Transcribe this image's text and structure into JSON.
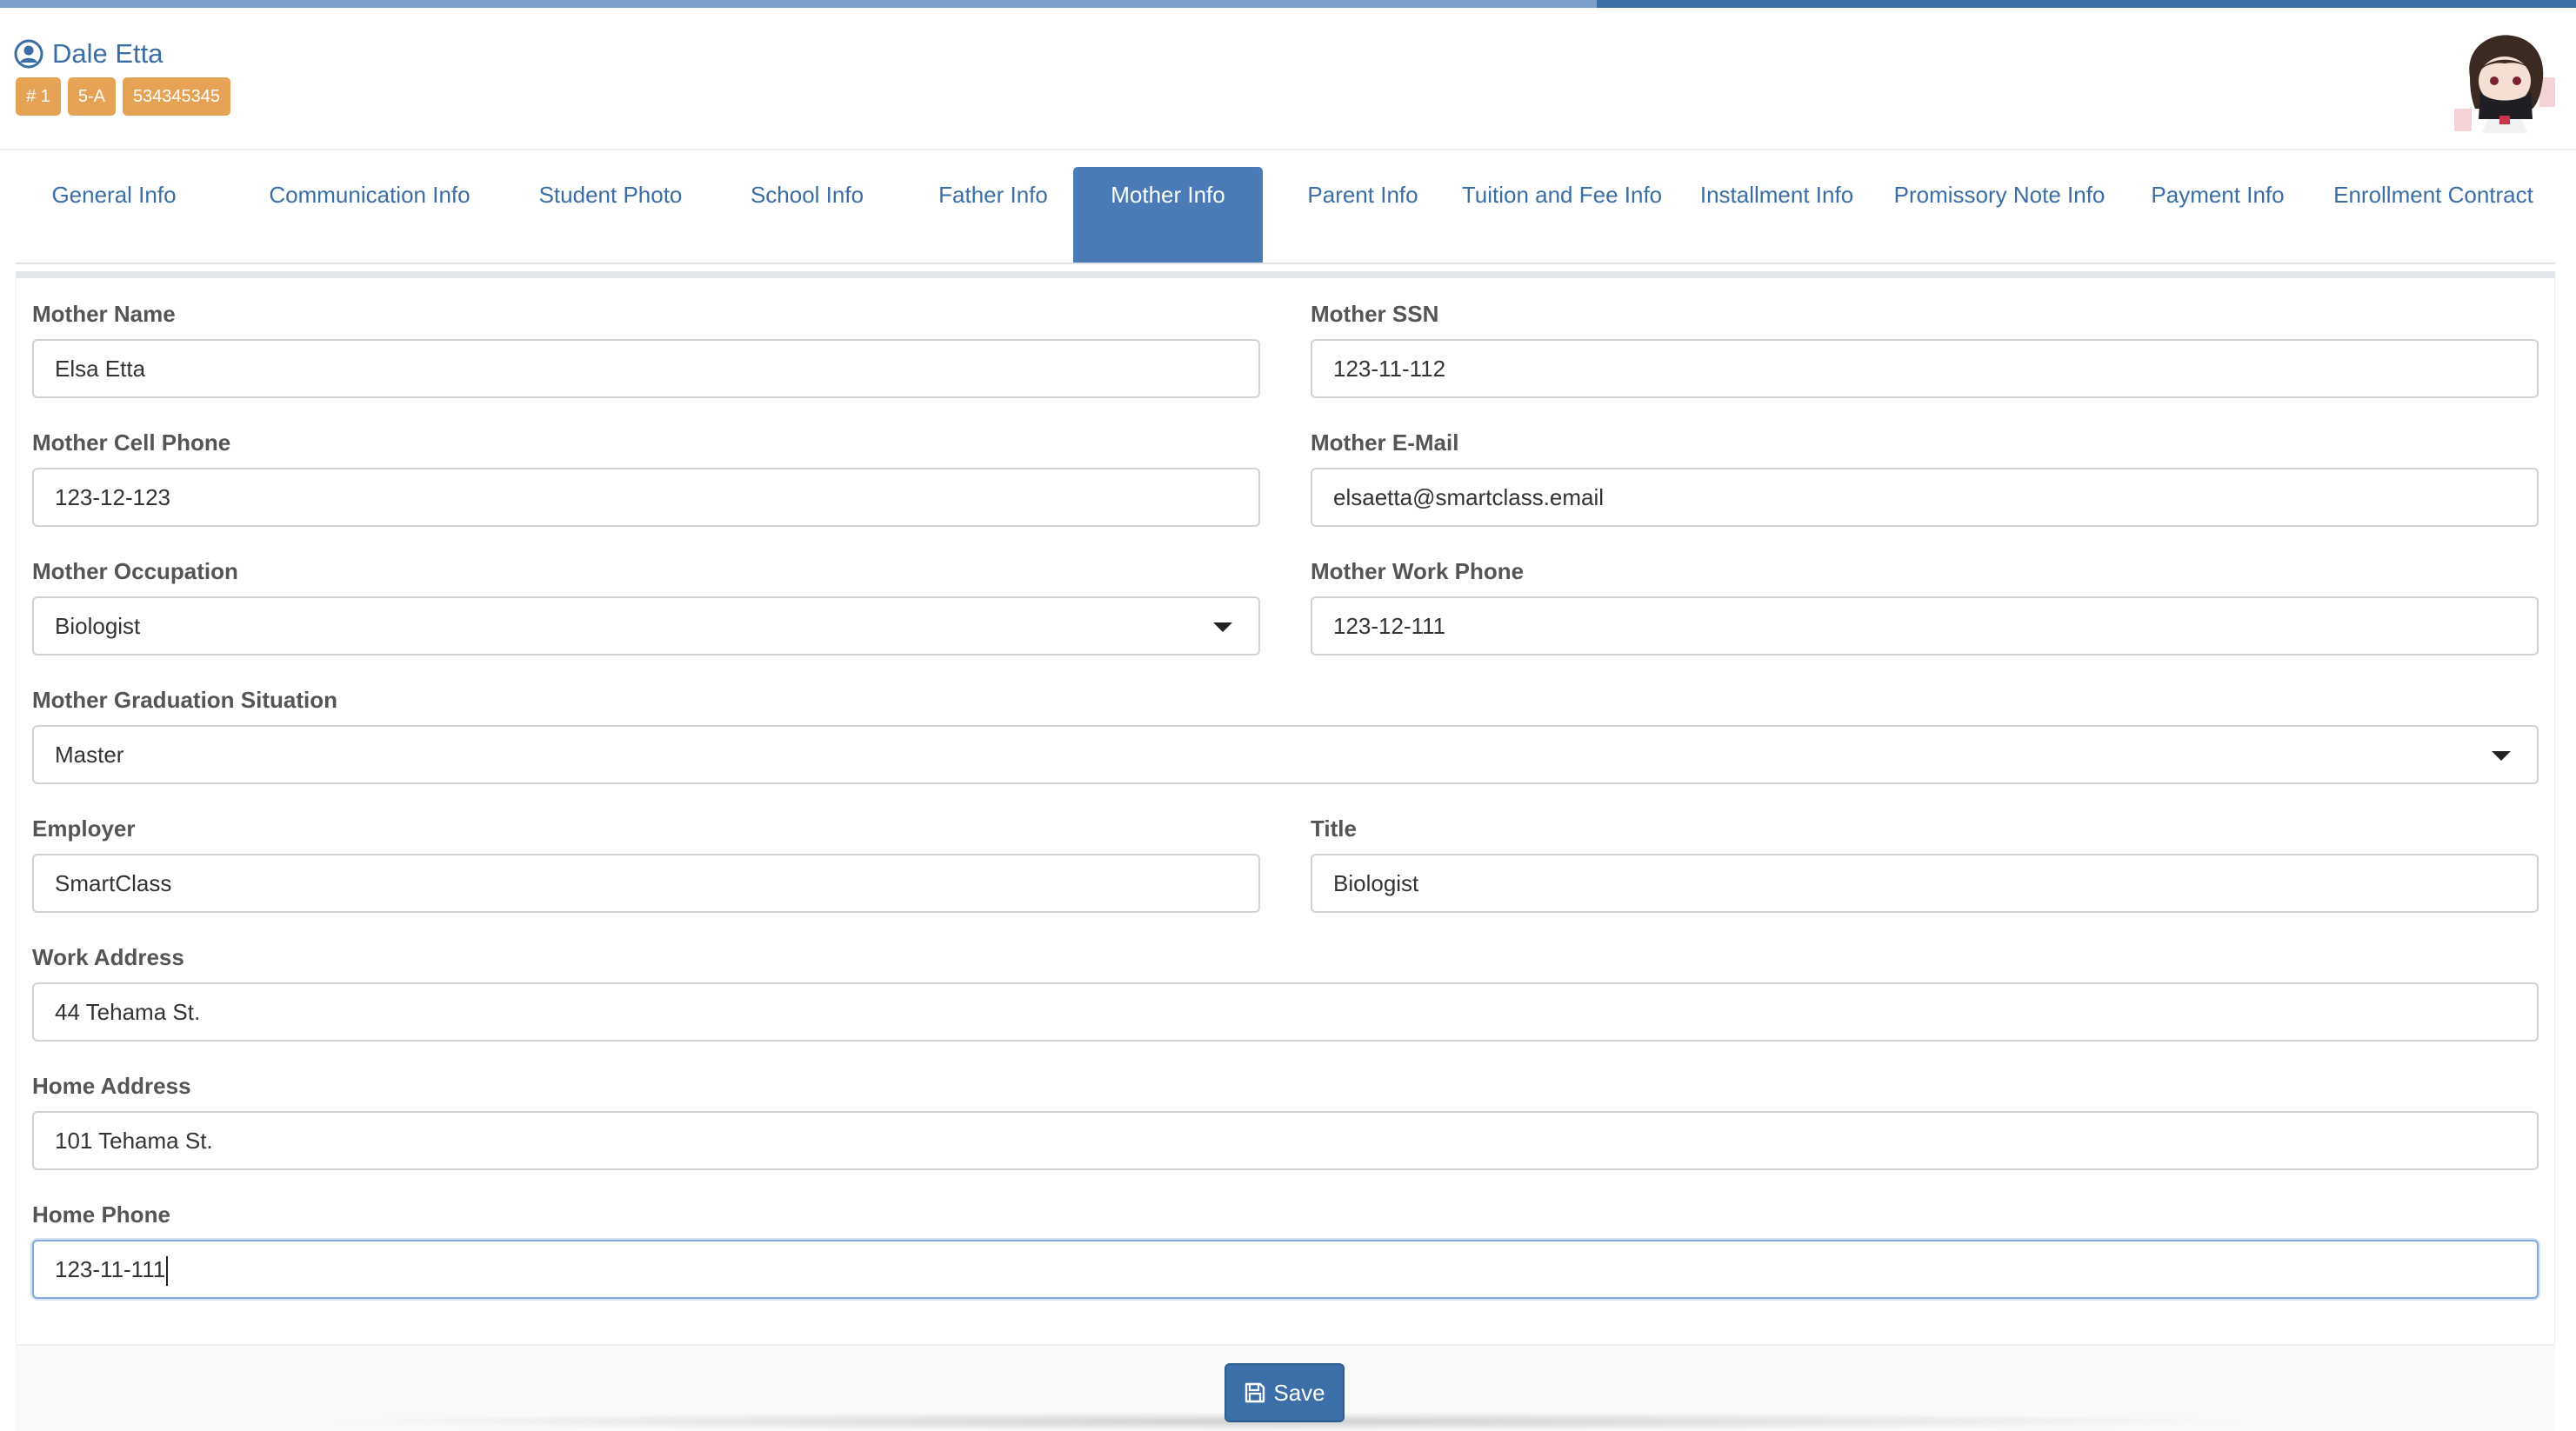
{
  "student": {
    "name": "Dale Etta",
    "badges": [
      "# 1",
      "5-A",
      "534345345"
    ]
  },
  "tabs": [
    {
      "label": "General Info"
    },
    {
      "label": "Communication Info"
    },
    {
      "label": "Student Photo"
    },
    {
      "label": "School Info"
    },
    {
      "label": "Father Info"
    },
    {
      "label": "Mother Info",
      "active": true
    },
    {
      "label": "Parent Info"
    },
    {
      "label": "Tuition and Fee Info"
    },
    {
      "label": "Installment Info"
    },
    {
      "label": "Promissory Note Info"
    },
    {
      "label": "Payment Info"
    },
    {
      "label": "Enrollment Contract"
    }
  ],
  "form": {
    "mother_name": {
      "label": "Mother Name",
      "value": "Elsa Etta"
    },
    "mother_ssn": {
      "label": "Mother SSN",
      "value": "123-11-112"
    },
    "mother_cell_phone": {
      "label": "Mother Cell Phone",
      "value": "123-12-123"
    },
    "mother_email": {
      "label": "Mother E-Mail",
      "value": "elsaetta@smartclass.email"
    },
    "mother_occupation": {
      "label": "Mother Occupation",
      "value": "Biologist"
    },
    "mother_work_phone": {
      "label": "Mother Work Phone",
      "value": "123-12-111"
    },
    "mother_graduation": {
      "label": "Mother Graduation Situation",
      "value": "Master"
    },
    "employer": {
      "label": "Employer",
      "value": "SmartClass"
    },
    "title": {
      "label": "Title",
      "value": "Biologist"
    },
    "work_address": {
      "label": "Work Address",
      "value": "44 Tehama St."
    },
    "home_address": {
      "label": "Home Address",
      "value": "101 Tehama St."
    },
    "home_phone": {
      "label": "Home Phone",
      "value": "123-11-111"
    }
  },
  "actions": {
    "save_label": "Save"
  },
  "colors": {
    "accent": "#3c6ea8",
    "badge": "#e6a356",
    "active_tab": "#4a7bb7"
  },
  "icons": {
    "user": "user-circle-icon",
    "save": "floppy-disk-icon"
  }
}
